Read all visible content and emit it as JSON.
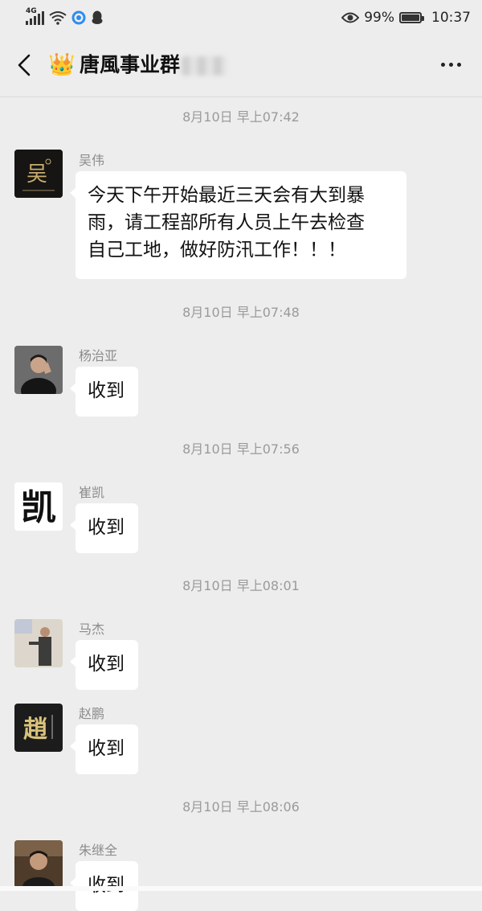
{
  "status_bar": {
    "network": "4G",
    "battery_percent": "99%",
    "battery_level": 0.99,
    "time": "10:37",
    "icons": [
      "signal-icon",
      "wifi-icon",
      "app-notification-icon",
      "qq-penguin-icon",
      "eye-icon",
      "battery-icon"
    ]
  },
  "header": {
    "back_icon": "chevron-left-icon",
    "crown_icon": "👑",
    "title": "唐風事业群",
    "more_icon": "more-dots-icon"
  },
  "messages": [
    {
      "time": "8月10日 早上07:42",
      "sender": "吴伟",
      "avatar_text": "吴",
      "lines": [
        "今天下午开始最近三天会有大到暴",
        "雨，请工程部所有人员上午去检查",
        "自己工地，做好防汛工作！！！"
      ]
    },
    {
      "time": "8月10日 早上07:48",
      "sender": "杨治亚",
      "text": "收到"
    },
    {
      "time": "8月10日 早上07:56",
      "sender": "崔凯",
      "avatar_text": "凯",
      "text": "收到"
    },
    {
      "time": "8月10日 早上08:01",
      "sender": "马杰",
      "text": "收到"
    },
    {
      "sender": "赵鹏",
      "avatar_text": "趙",
      "text": "收到"
    },
    {
      "time": "8月10日 早上08:06",
      "sender": "朱继全",
      "text": "收到"
    }
  ],
  "colors": {
    "background": "#ededed",
    "bubble": "#ffffff",
    "timestamp": "#9a9a9a",
    "sender_name": "#8c8c8c"
  }
}
